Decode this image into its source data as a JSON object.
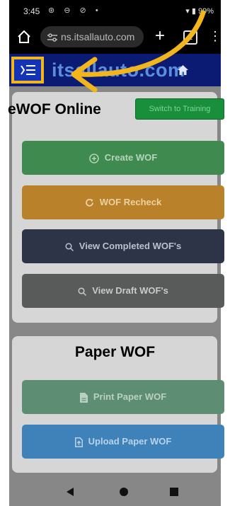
{
  "status": {
    "time": "3:45",
    "icons": "⊛ ⊖ ⊘ •",
    "battery": "99%"
  },
  "browser": {
    "url": "ns.itsallauto.com",
    "tab_count": "1"
  },
  "site": {
    "logo_text": "itsallauto.com"
  },
  "online": {
    "title": "eWOF Online",
    "switch_label": "Switch to Training"
  },
  "buttons": {
    "create": "Create WOF",
    "recheck": "WOF Recheck",
    "completed": "View Completed WOF's",
    "draft": "View Draft WOF's"
  },
  "paper": {
    "title": "Paper WOF",
    "print": "Print Paper WOF",
    "upload": "Upload Paper WOF"
  },
  "colors": {
    "highlight": "#f2b51b",
    "header": "#0b1a73",
    "menu_button": "#1434b8"
  }
}
